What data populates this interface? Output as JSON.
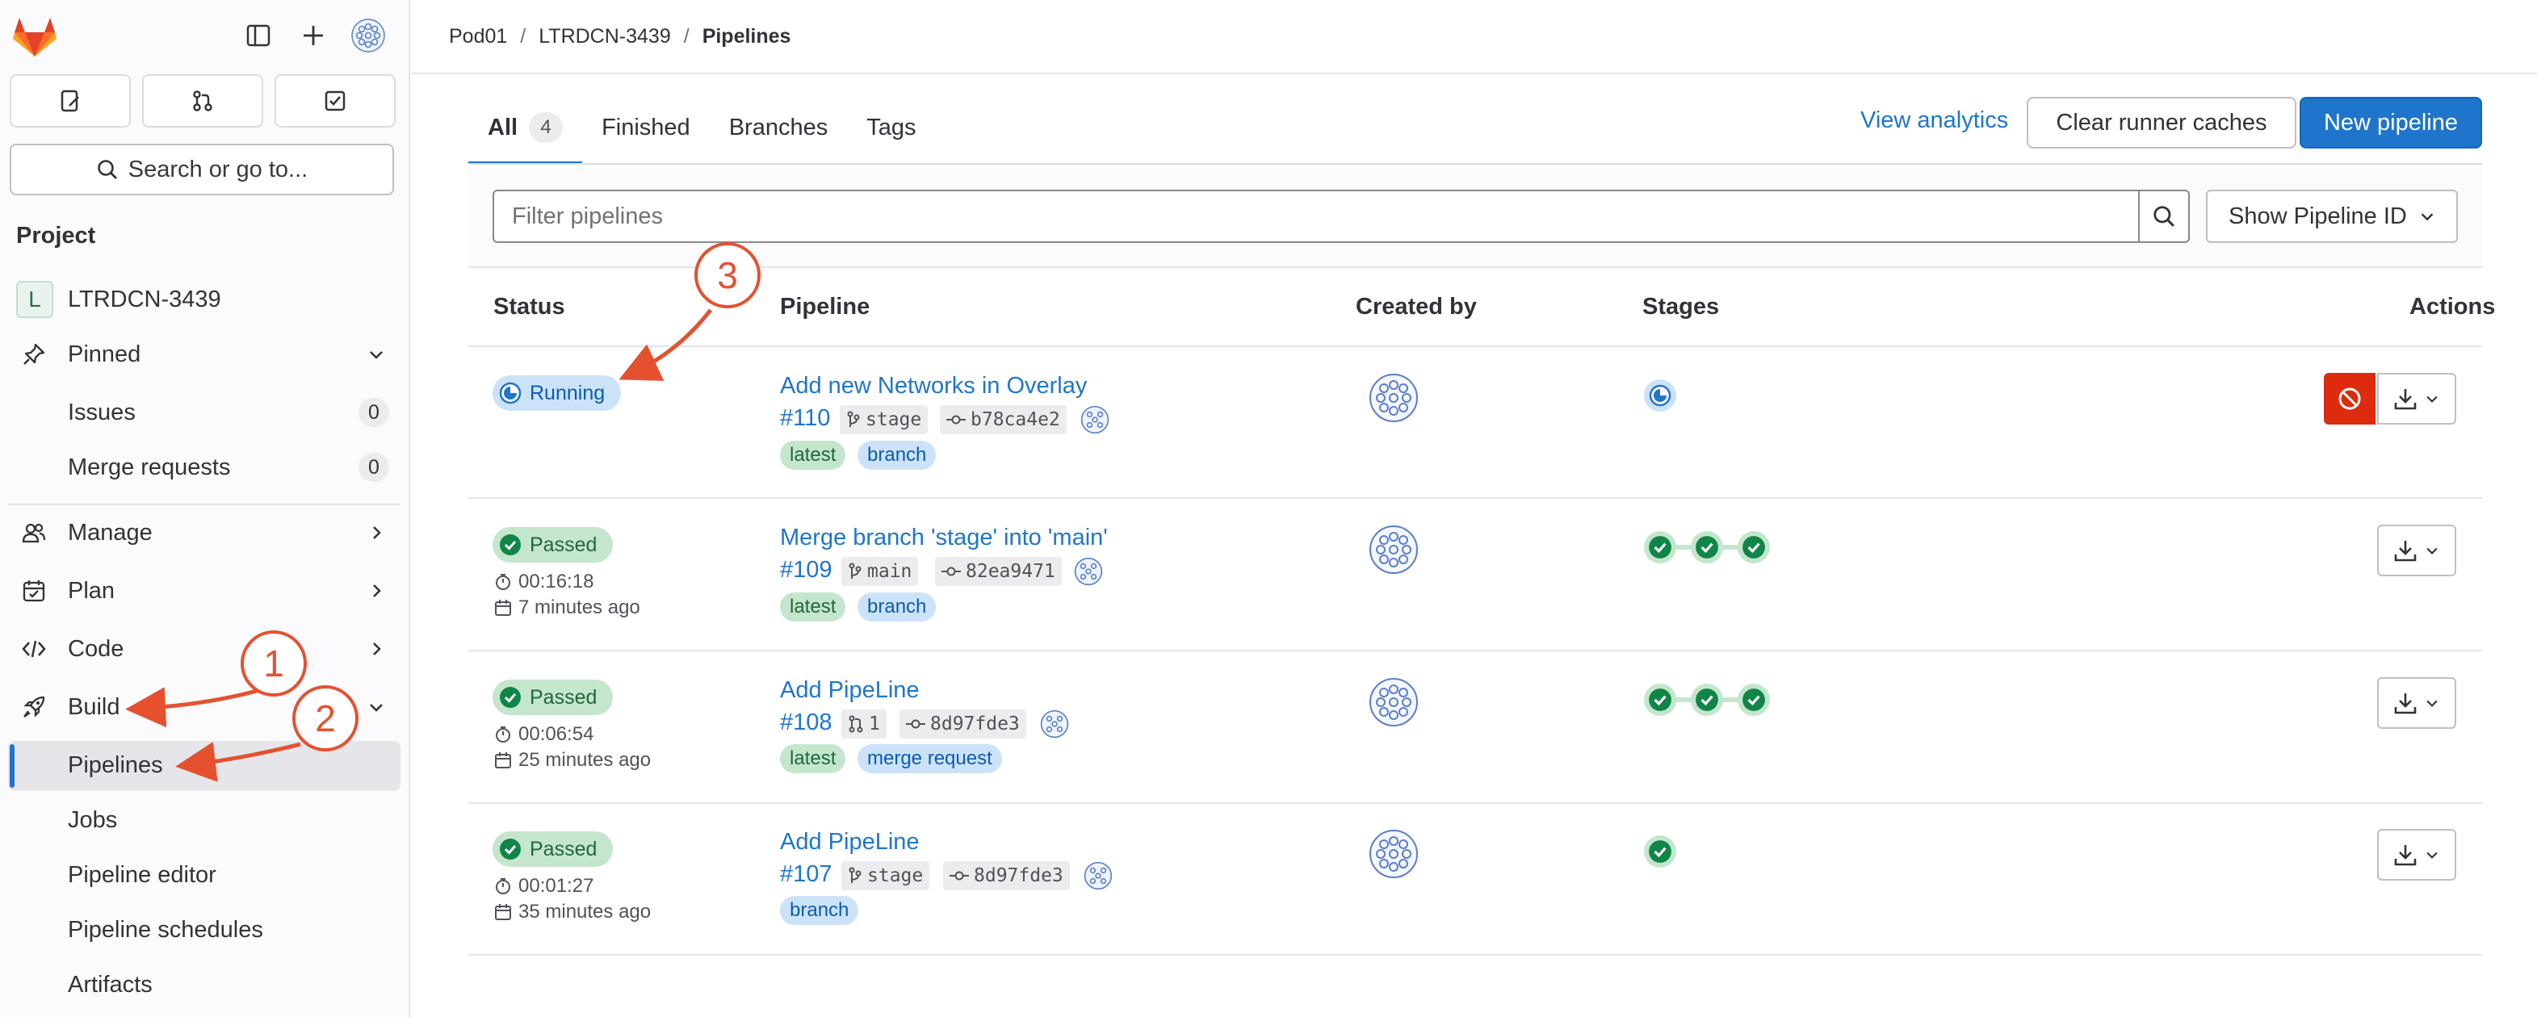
{
  "sidebar": {
    "search_label": "Search or go to...",
    "section_heading": "Project",
    "project_initial": "L",
    "project_name": "LTRDCN-3439",
    "items": {
      "pinned": "Pinned",
      "issues": "Issues",
      "issues_count": "0",
      "merge_requests": "Merge requests",
      "merge_requests_count": "0",
      "manage": "Manage",
      "plan": "Plan",
      "code": "Code",
      "build": "Build",
      "pipelines": "Pipelines",
      "jobs": "Jobs",
      "pipeline_editor": "Pipeline editor",
      "pipeline_schedules": "Pipeline schedules",
      "artifacts": "Artifacts"
    }
  },
  "breadcrumb": {
    "group": "Pod01",
    "project": "LTRDCN-3439",
    "current": "Pipelines"
  },
  "tabs": [
    {
      "label": "All",
      "count": "4"
    },
    {
      "label": "Finished"
    },
    {
      "label": "Branches"
    },
    {
      "label": "Tags"
    }
  ],
  "actions": {
    "view_analytics": "View analytics",
    "clear_caches": "Clear runner caches",
    "new_pipeline": "New pipeline"
  },
  "filter": {
    "placeholder": "Filter pipelines",
    "show_id": "Show Pipeline ID"
  },
  "table": {
    "headers": {
      "status": "Status",
      "pipeline": "Pipeline",
      "created_by": "Created by",
      "stages": "Stages",
      "actions": "Actions"
    },
    "rows": [
      {
        "status": "Running",
        "title": "Add new Networks in Overlay",
        "id": "#110",
        "ref": "stage",
        "sha": "b78ca4e2",
        "labels": [
          "latest",
          "branch"
        ]
      },
      {
        "status": "Passed",
        "duration": "00:16:18",
        "ago": "7 minutes ago",
        "title": "Merge branch 'stage' into 'main'",
        "id": "#109",
        "ref": "main",
        "sha": "82ea9471",
        "labels": [
          "latest",
          "branch"
        ]
      },
      {
        "status": "Passed",
        "duration": "00:06:54",
        "ago": "25 minutes ago",
        "title": "Add PipeLine",
        "id": "#108",
        "ref": "1",
        "sha": "8d97fde3",
        "labels": [
          "latest",
          "merge request"
        ]
      },
      {
        "status": "Passed",
        "duration": "00:01:27",
        "ago": "35 minutes ago",
        "title": "Add PipeLine",
        "id": "#107",
        "ref": "stage",
        "sha": "8d97fde3",
        "labels": [
          "branch"
        ]
      }
    ]
  },
  "annotations": {
    "one": "1",
    "two": "2",
    "three": "3"
  },
  "colors": {
    "accent": "#1f75cb",
    "success": "#108548",
    "danger": "#dd2b0e",
    "annotation": "#e5512f"
  }
}
